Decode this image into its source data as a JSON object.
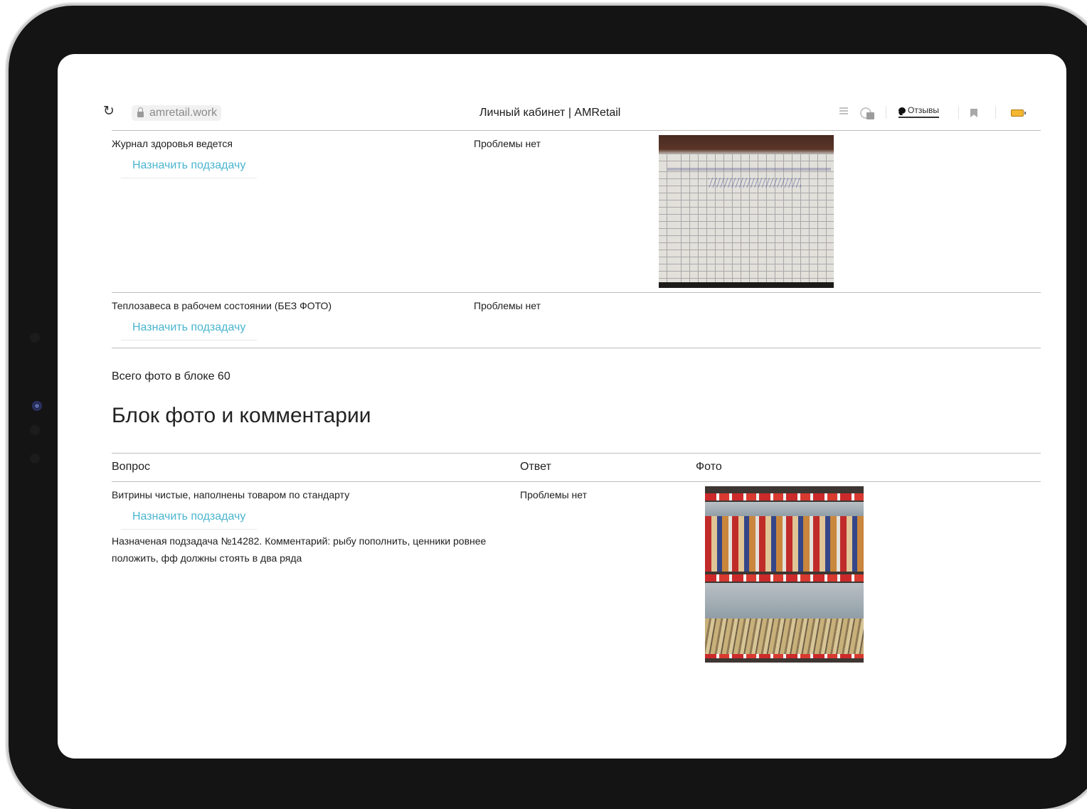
{
  "browser": {
    "url": "amretail.work",
    "tab_title": "Личный кабинет | AMRetail",
    "feedback_label": "Отзывы"
  },
  "checklist": [
    {
      "question": "Журнал здоровья ведется",
      "answer": "Проблемы нет",
      "action": "Назначить подзадачу"
    },
    {
      "question": "Теплозавеса в рабочем состоянии (БЕЗ ФОТО)",
      "answer": "Проблемы нет",
      "action": "Назначить подзадачу"
    }
  ],
  "summary": "Всего фото в блоке 60",
  "section": {
    "title": "Блок фото и комментарии",
    "columns": [
      "Вопрос",
      "Ответ",
      "Фото"
    ],
    "rows": [
      {
        "question": "Витрины чистые, наполнены товаром по стандарту",
        "answer": "Проблемы нет",
        "action": "Назначить подзадачу",
        "comment": "Назначеная подзадача №14282. Комментарий: рыбу пополнить, ценники ровнее положить, фф должны стоять в два ряда"
      }
    ]
  },
  "icons": [
    "reload-icon",
    "lock-icon",
    "list-icon",
    "reader-icon",
    "chat-bubble-icon",
    "bookmark-icon",
    "battery-icon"
  ],
  "colors": {
    "link": "#4ab5cf",
    "frame": "#141414",
    "battery": "#f5b731"
  }
}
